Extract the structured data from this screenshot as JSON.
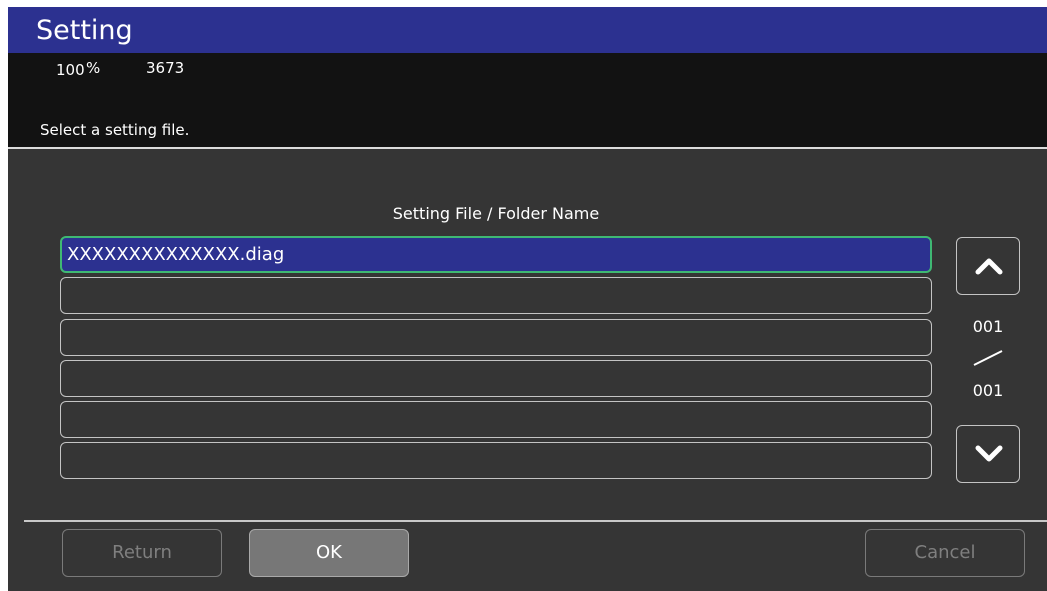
{
  "title": "Setting",
  "status": {
    "zoom_value": "100",
    "zoom_unit": "%",
    "count": "3673"
  },
  "message": "Select a setting file.",
  "file_list": {
    "column_header": "Setting File / Folder Name",
    "rows": [
      {
        "name": "XXXXXXXXXXXXXX.diag",
        "selected": true
      },
      {
        "name": "",
        "selected": false
      },
      {
        "name": "",
        "selected": false
      },
      {
        "name": "",
        "selected": false
      },
      {
        "name": "",
        "selected": false
      },
      {
        "name": "",
        "selected": false
      }
    ]
  },
  "pagination": {
    "current_page": "001",
    "total_pages": "001",
    "up_icon": "chevron-up-icon",
    "down_icon": "chevron-down-icon"
  },
  "buttons": {
    "return_label": "Return",
    "ok_label": "OK",
    "cancel_label": "Cancel"
  },
  "colors": {
    "title_bar": "#2c3190",
    "background": "#353535",
    "info_background": "#121212",
    "selected_row": "#2c3190",
    "selected_border": "#3fb873"
  }
}
